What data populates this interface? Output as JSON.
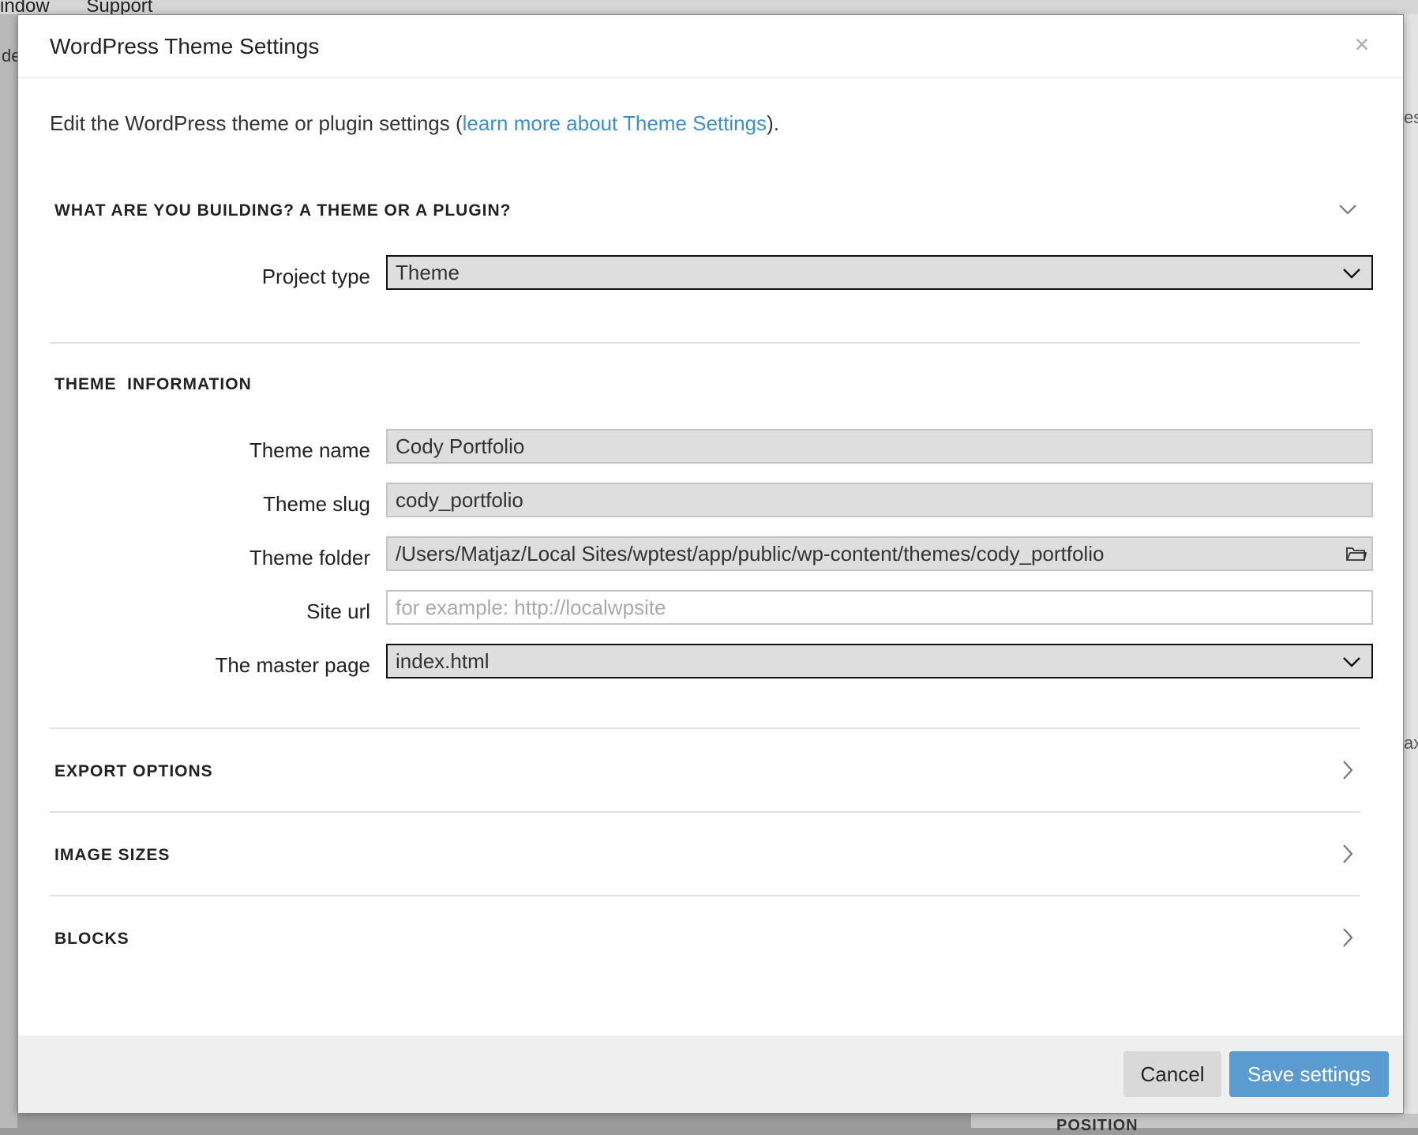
{
  "background": {
    "menu_items": [
      "indow",
      "Support"
    ],
    "left_fragment": "de",
    "right_fragment_1": "es",
    "right_fragment_2": "ax",
    "bottom_fragment": "POSITION"
  },
  "dialog": {
    "title": "WordPress Theme Settings",
    "close_symbol": "×",
    "intro": {
      "before": "Edit the WordPress theme or plugin settings (",
      "link": "learn more about Theme Settings",
      "after": ")."
    },
    "sections": {
      "project": {
        "heading": "WHAT ARE YOU BUILDING? A THEME OR A PLUGIN?",
        "state": "expanded",
        "project_type_label": "Project type",
        "project_type_value": "Theme"
      },
      "theme_info": {
        "heading": "THEME  INFORMATION",
        "theme_name_label": "Theme name",
        "theme_name_value": "Cody Portfolio",
        "theme_slug_label": "Theme slug",
        "theme_slug_value": "cody_portfolio",
        "theme_folder_label": "Theme folder",
        "theme_folder_value": "/Users/Matjaz/Local Sites/wptest/app/public/wp-content/themes/cody_portfolio",
        "site_url_label": "Site url",
        "site_url_placeholder": "for example: http://localwpsite",
        "master_page_label": "The master page",
        "master_page_value": "index.html"
      },
      "export_options": {
        "heading": "EXPORT OPTIONS",
        "state": "collapsed"
      },
      "image_sizes": {
        "heading": "IMAGE SIZES",
        "state": "collapsed"
      },
      "blocks": {
        "heading": "BLOCKS",
        "state": "collapsed"
      }
    },
    "footer": {
      "cancel_label": "Cancel",
      "save_label": "Save settings"
    }
  },
  "colors": {
    "link": "#3f8fc3",
    "primary_button": "#5a9bd0",
    "secondary_button": "#d9d9d9",
    "footer_bg": "#efefef"
  },
  "icons": [
    "close-icon",
    "chevron-down-icon",
    "chevron-right-icon",
    "folder-icon"
  ]
}
